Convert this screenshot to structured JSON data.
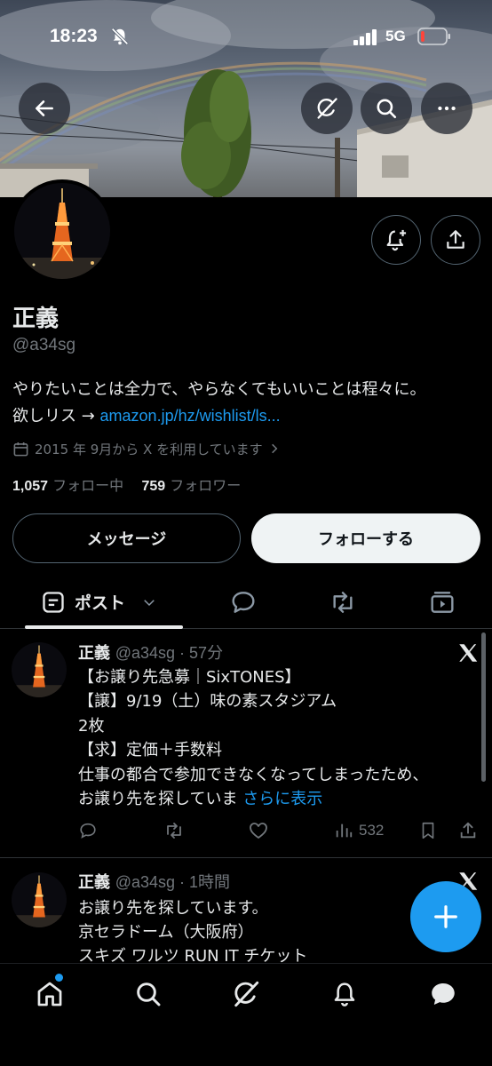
{
  "status_bar": {
    "time": "18:23",
    "network": "5G",
    "silent": true,
    "battery_level": 0.15,
    "battery_color": "#ff453a"
  },
  "banner": {
    "description_icons": [
      "back-arrow-icon",
      "grok-icon",
      "search-icon",
      "more-icon"
    ]
  },
  "profile": {
    "display_name": "正義",
    "handle": "@a34sg",
    "bio_line1": "やりたいことは全力で、やらなくてもいいことは程々に。",
    "bio_line2_prefix": "欲しリス → ",
    "bio_link": "amazon.jp/hz/wishlist/ls...",
    "joined": "2015 年 9月から X を利用しています",
    "following_count": "1,057",
    "following_label": "フォロー中",
    "followers_count": "759",
    "followers_label": "フォロワー"
  },
  "buttons": {
    "message": "メッセージ",
    "follow": "フォローする"
  },
  "tabs": {
    "posts": "ポスト"
  },
  "posts": [
    {
      "name": "正義",
      "meta": "@a34sg · 57分",
      "lines": [
        "【お譲り先急募｜SixTONES】",
        "【譲】9/19（土）味の素スタジアム",
        "2枚",
        "【求】定価＋手数料",
        "仕事の都合で参加できなくなってしまったため、",
        "お譲り先を探していま"
      ],
      "show_more": "さらに表示",
      "views": "532"
    },
    {
      "name": "正義",
      "meta": "@a34sg · 1時間",
      "lines": [
        "お譲り先を探しています。",
        "京セラドーム（大阪府）",
        "スキズ ワルツ RUN IT チケット"
      ]
    }
  ],
  "colors": {
    "accent": "#1d9bf0",
    "text": "#e7e9ea",
    "muted": "#71767b",
    "border": "#2f3336",
    "background": "#000000"
  }
}
